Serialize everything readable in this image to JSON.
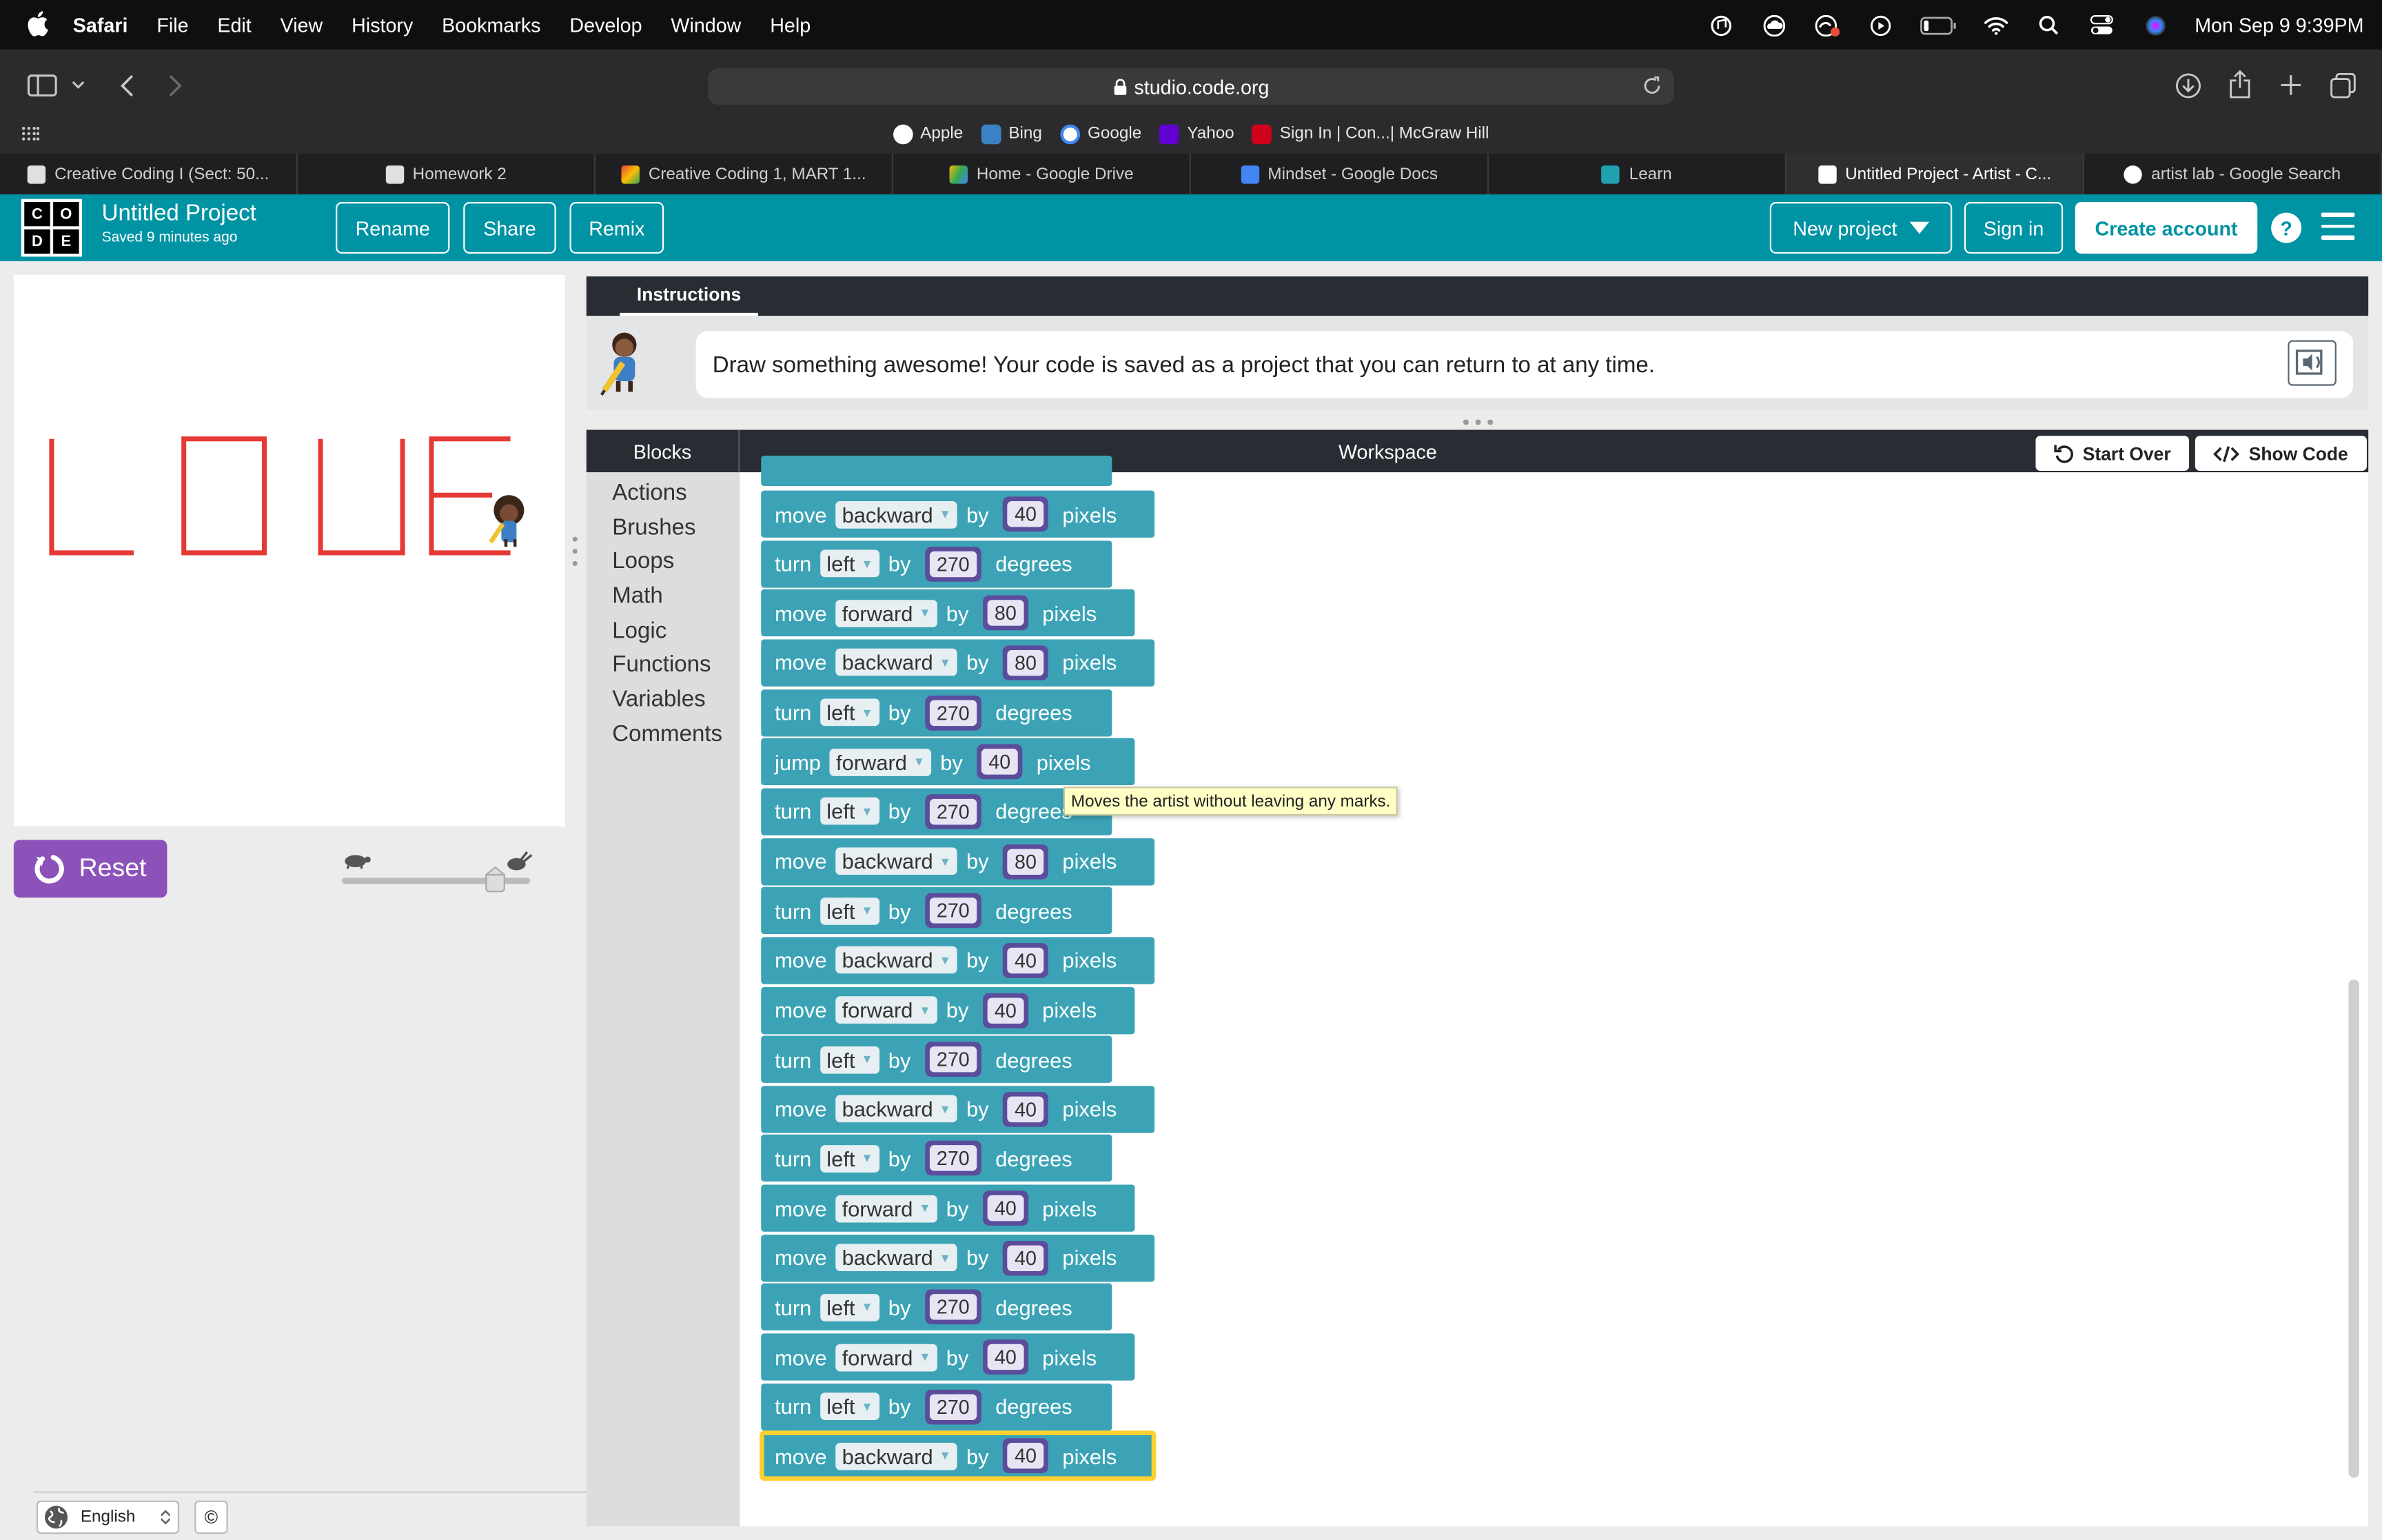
{
  "menubar": {
    "app": "Safari",
    "menus": [
      "File",
      "Edit",
      "View",
      "History",
      "Bookmarks",
      "Develop",
      "Window",
      "Help"
    ],
    "clock": "Mon Sep 9  9:39PM"
  },
  "browser": {
    "url": "studio.code.org",
    "favorites": [
      {
        "label": "Apple",
        "color": "#ffffff"
      },
      {
        "label": "Bing",
        "color": "#3b82c4"
      },
      {
        "label": "Google",
        "color": "#ffffff"
      },
      {
        "label": "Yahoo",
        "color": "#6001d2"
      },
      {
        "label": "Sign In | Con...| McGraw Hill",
        "color": "#d0021b"
      }
    ],
    "tabs": [
      {
        "label": "Creative Coding I (Sect: 50...",
        "color": "#c8c8c8",
        "active": false
      },
      {
        "label": "Homework 2",
        "color": "#c8c8c8",
        "active": false
      },
      {
        "label": "Creative Coding 1, MART 1...",
        "color": "#e94235",
        "active": false
      },
      {
        "label": "Home - Google Drive",
        "color": "#fbbc04",
        "active": false
      },
      {
        "label": "Mindset - Google Docs",
        "color": "#4285f4",
        "active": false
      },
      {
        "label": "Learn",
        "color": "#21a0b0",
        "active": false
      },
      {
        "label": "Untitled Project - Artist - C...",
        "color": "#ffffff",
        "active": true
      },
      {
        "label": "artist lab - Google Search",
        "color": "#ffffff",
        "active": false
      }
    ]
  },
  "header": {
    "logo_letters": [
      "C",
      "O",
      "D",
      "E"
    ],
    "project_title": "Untitled Project",
    "saved_status": "Saved 9 minutes ago",
    "rename": "Rename",
    "share": "Share",
    "remix": "Remix",
    "new_project": "New project",
    "sign_in": "Sign in",
    "create_account": "Create account",
    "help": "?"
  },
  "left": {
    "reset": "Reset",
    "language": "English",
    "copyright": "©",
    "drawing_color": "#e53935",
    "drawn_letters": "LOUE"
  },
  "instructions": {
    "tab": "Instructions",
    "text": "Draw something awesome! Your code is saved as a project that you can return to at any time."
  },
  "workspace": {
    "blocks_label": "Blocks",
    "workspace_label": "Workspace",
    "start_over": "Start Over",
    "show_code": "Show Code",
    "categories": [
      "Actions",
      "Brushes",
      "Loops",
      "Math",
      "Logic",
      "Functions",
      "Variables",
      "Comments"
    ],
    "tooltip": "Moves the artist without leaving any marks.",
    "block_color": "#3ba3b5",
    "program": [
      {
        "verb": "move",
        "dir": "backward",
        "value": "40",
        "unit": "pixels"
      },
      {
        "verb": "turn",
        "dir": "left",
        "value": "270",
        "unit": "degrees"
      },
      {
        "verb": "move",
        "dir": "forward",
        "value": "80",
        "unit": "pixels"
      },
      {
        "verb": "move",
        "dir": "backward",
        "value": "80",
        "unit": "pixels"
      },
      {
        "verb": "turn",
        "dir": "left",
        "value": "270",
        "unit": "degrees"
      },
      {
        "verb": "jump",
        "dir": "forward",
        "value": "40",
        "unit": "pixels"
      },
      {
        "verb": "turn",
        "dir": "left",
        "value": "270",
        "unit": "degrees"
      },
      {
        "verb": "move",
        "dir": "backward",
        "value": "80",
        "unit": "pixels"
      },
      {
        "verb": "turn",
        "dir": "left",
        "value": "270",
        "unit": "degrees"
      },
      {
        "verb": "move",
        "dir": "backward",
        "value": "40",
        "unit": "pixels"
      },
      {
        "verb": "move",
        "dir": "forward",
        "value": "40",
        "unit": "pixels"
      },
      {
        "verb": "turn",
        "dir": "left",
        "value": "270",
        "unit": "degrees"
      },
      {
        "verb": "move",
        "dir": "backward",
        "value": "40",
        "unit": "pixels"
      },
      {
        "verb": "turn",
        "dir": "left",
        "value": "270",
        "unit": "degrees"
      },
      {
        "verb": "move",
        "dir": "forward",
        "value": "40",
        "unit": "pixels"
      },
      {
        "verb": "move",
        "dir": "backward",
        "value": "40",
        "unit": "pixels"
      },
      {
        "verb": "turn",
        "dir": "left",
        "value": "270",
        "unit": "degrees"
      },
      {
        "verb": "move",
        "dir": "forward",
        "value": "40",
        "unit": "pixels"
      },
      {
        "verb": "turn",
        "dir": "left",
        "value": "270",
        "unit": "degrees"
      },
      {
        "verb": "move",
        "dir": "backward",
        "value": "40",
        "unit": "pixels",
        "selected": true
      }
    ],
    "connector_word": "by"
  }
}
